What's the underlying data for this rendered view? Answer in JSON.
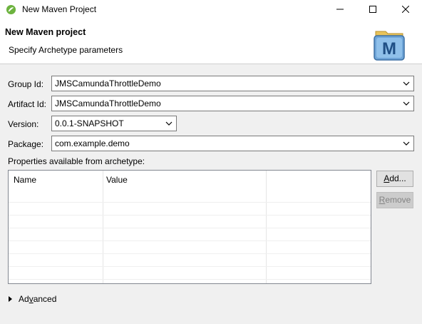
{
  "window": {
    "title": "New Maven Project",
    "controls": {
      "minimize": "minimize",
      "maximize": "maximize",
      "close": "close"
    }
  },
  "banner": {
    "title": "New Maven project",
    "subtitle": "Specify Archetype parameters",
    "icon_letter": "M"
  },
  "form": {
    "group_id": {
      "label": "Group Id:",
      "value": "JMSCamundaThrottleDemo"
    },
    "artifact_id": {
      "label": "Artifact Id:",
      "value": "JMSCamundaThrottleDemo"
    },
    "version": {
      "label": "Version:",
      "value": "0.0.1-SNAPSHOT"
    },
    "package": {
      "label": "Package:",
      "value": "com.example.demo"
    }
  },
  "properties": {
    "label": "Properties available from archetype:",
    "columns": [
      "Name",
      "Value"
    ],
    "rows": []
  },
  "buttons": {
    "add": {
      "mnemonic": "A",
      "rest": "dd..."
    },
    "remove": {
      "mnemonic": "R",
      "rest": "emove",
      "enabled": false
    }
  },
  "advanced": {
    "prefix": "Ad",
    "mnemonic": "v",
    "rest": "anced"
  },
  "colors": {
    "remove_disabled_bg": "#cccccc",
    "dialog_bg": "#f0f0f0"
  }
}
